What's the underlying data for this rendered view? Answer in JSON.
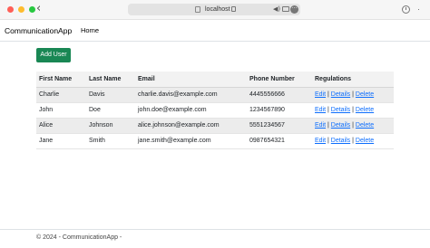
{
  "browser": {
    "url": "localhost",
    "icons": [
      "back-icon",
      "tab-icon",
      "lock-icon",
      "speaker-icon",
      "reader-icon",
      "more-icon",
      "clock-icon",
      "menu-icon"
    ]
  },
  "nav": {
    "brand": "CommunicationApp",
    "home": "Home"
  },
  "actions": {
    "add_user": "Add User",
    "add_user_color": "#198754",
    "link_color": "#0d6efd"
  },
  "table": {
    "headers": [
      "First Name",
      "Last Name",
      "Email",
      "Phone Number",
      "Regulations"
    ],
    "rows": [
      {
        "first": "Charlie",
        "last": "Davis",
        "email": "charlie.davis@example.com",
        "phone": "4445556666",
        "edit": "Edit",
        "details": "Details",
        "delete": "Delete"
      },
      {
        "first": "John",
        "last": "Doe",
        "email": "john.doe@example.com",
        "phone": "1234567890",
        "edit": "Edit",
        "details": "Details",
        "delete": "Delete"
      },
      {
        "first": "Alice",
        "last": "Johnson",
        "email": "alice.johnson@example.com",
        "phone": "5551234567",
        "edit": "Edit",
        "details": "Details",
        "delete": "Delete"
      },
      {
        "first": "Jane",
        "last": "Smith",
        "email": "jane.smith@example.com",
        "phone": "0987654321",
        "edit": "Edit",
        "details": "Details",
        "delete": "Delete"
      }
    ]
  },
  "footer": {
    "text": "© 2024 - CommunicationApp -"
  }
}
